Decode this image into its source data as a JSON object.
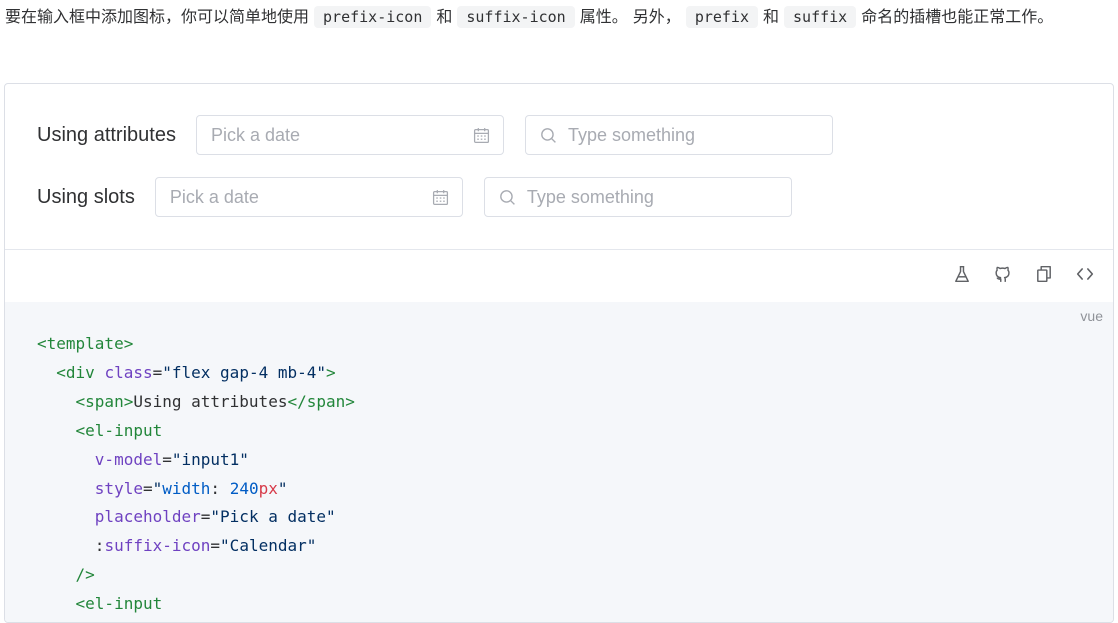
{
  "description": {
    "part1": "要在输入框中添加图标，你可以简单地使用",
    "code1": "prefix-icon",
    "part2": "和",
    "code2": "suffix-icon",
    "part3": "属性。 另外，",
    "code3": "prefix",
    "part4": "和",
    "code4": "suffix",
    "part5": "命名的插槽也能正常工作。"
  },
  "demo": {
    "rows": [
      {
        "label": "Using attributes",
        "date_placeholder": "Pick a date",
        "text_placeholder": "Type something"
      },
      {
        "label": "Using slots",
        "date_placeholder": "Pick a date",
        "text_placeholder": "Type something"
      }
    ]
  },
  "toolbar": {
    "icons": [
      "playground-flask-icon",
      "github-icon",
      "copy-icon",
      "code-toggle-icon"
    ]
  },
  "code": {
    "language": "vue",
    "lines": [
      [
        [
          "tg",
          "<template>"
        ]
      ],
      [
        [
          "",
          "  "
        ],
        [
          "tg",
          "<div"
        ],
        [
          "",
          " "
        ],
        [
          "at",
          "class"
        ],
        [
          "",
          "="
        ],
        [
          "st",
          "\"flex gap-4 mb-4\""
        ],
        [
          "tg",
          ">"
        ]
      ],
      [
        [
          "",
          "    "
        ],
        [
          "tg",
          "<span>"
        ],
        [
          "",
          "Using attributes"
        ],
        [
          "tg",
          "</span>"
        ]
      ],
      [
        [
          "",
          "    "
        ],
        [
          "tg",
          "<el-input"
        ]
      ],
      [
        [
          "",
          "      "
        ],
        [
          "at",
          "v-model"
        ],
        [
          "",
          "="
        ],
        [
          "st",
          "\"input1\""
        ]
      ],
      [
        [
          "",
          "      "
        ],
        [
          "at",
          "style"
        ],
        [
          "",
          "="
        ],
        [
          "st",
          "\""
        ],
        [
          "kw",
          "width"
        ],
        [
          "",
          ": "
        ],
        [
          "nm",
          "240"
        ],
        [
          "un",
          "px"
        ],
        [
          "st",
          "\""
        ]
      ],
      [
        [
          "",
          "      "
        ],
        [
          "at",
          "placeholder"
        ],
        [
          "",
          "="
        ],
        [
          "st",
          "\"Pick a date\""
        ]
      ],
      [
        [
          "",
          "      :"
        ],
        [
          "at",
          "suffix-icon"
        ],
        [
          "",
          "="
        ],
        [
          "st",
          "\"Calendar\""
        ]
      ],
      [
        [
          "",
          "    "
        ],
        [
          "tg",
          "/>"
        ]
      ],
      [
        [
          "",
          "    "
        ],
        [
          "tg",
          "<el-input"
        ]
      ]
    ]
  }
}
